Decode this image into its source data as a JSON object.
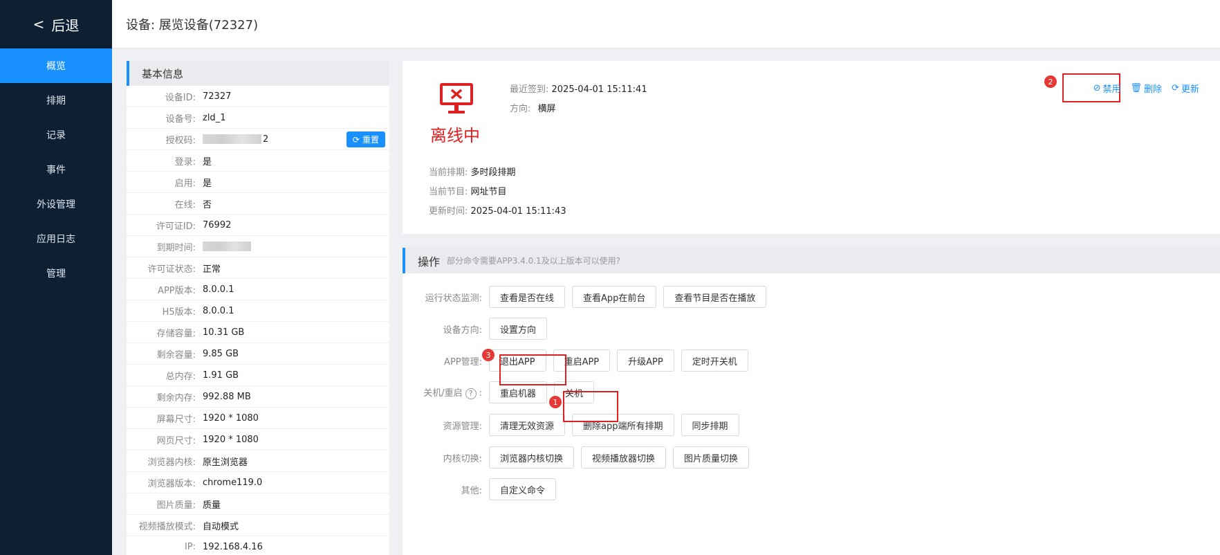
{
  "sidebar": {
    "back_label": "后退",
    "items": [
      {
        "label": "概览",
        "active": true
      },
      {
        "label": "排期"
      },
      {
        "label": "记录"
      },
      {
        "label": "事件"
      },
      {
        "label": "外设管理"
      },
      {
        "label": "应用日志"
      },
      {
        "label": "管理"
      }
    ]
  },
  "header": {
    "title": "设备: 展览设备(72327)"
  },
  "info": {
    "title": "基本信息",
    "reset_label": "重置",
    "rows": [
      {
        "label": "设备ID:",
        "value": "72327"
      },
      {
        "label": "设备号:",
        "value": "zld_1"
      },
      {
        "label": "授权码:",
        "value": "2"
      },
      {
        "label": "登录:",
        "value": "是"
      },
      {
        "label": "启用:",
        "value": "是"
      },
      {
        "label": "在线:",
        "value": "否"
      },
      {
        "label": "许可证ID:",
        "value": "76992"
      },
      {
        "label": "到期时间:",
        "value": ""
      },
      {
        "label": "许可证状态:",
        "value": "正常"
      },
      {
        "label": "APP版本:",
        "value": "8.0.0.1"
      },
      {
        "label": "H5版本:",
        "value": "8.0.0.1"
      },
      {
        "label": "存储容量:",
        "value": "10.31 GB"
      },
      {
        "label": "剩余容量:",
        "value": "9.85 GB"
      },
      {
        "label": "总内存:",
        "value": "1.91 GB"
      },
      {
        "label": "剩余内存:",
        "value": "992.88 MB"
      },
      {
        "label": "屏幕尺寸:",
        "value": "1920 * 1080"
      },
      {
        "label": "网页尺寸:",
        "value": "1920 * 1080"
      },
      {
        "label": "浏览器内核:",
        "value": "原生浏览器"
      },
      {
        "label": "浏览器版本:",
        "value": "chrome119.0"
      },
      {
        "label": "图片质量:",
        "value": "质量"
      },
      {
        "label": "视频播放模式:",
        "value": "自动模式"
      },
      {
        "label": "IP:",
        "value": "192.168.4.16"
      }
    ]
  },
  "status": {
    "state": "离线中",
    "last_signin_label": "最近签到:",
    "last_signin": "2025-04-01 15:11:41",
    "orientation_label": "方向:",
    "orientation": "横屏",
    "schedule_label": "当前排期:",
    "schedule": "多时段排期",
    "program_label": "当前节目:",
    "program": "网址节目",
    "updated_label": "更新时间:",
    "updated": "2025-04-01 15:11:43",
    "actions": {
      "disable": "禁用",
      "delete": "删除",
      "update": "更新"
    },
    "colors": {
      "offline": "#e02020",
      "accent": "#1890ff"
    }
  },
  "ops": {
    "title": "操作",
    "subtitle": "部分命令需要APP3.4.0.1及以上版本可以使用?",
    "rows": [
      {
        "label": "运行状态监测:",
        "buttons": [
          "查看是否在线",
          "查看App在前台",
          "查看节目是否在播放"
        ]
      },
      {
        "label": "设备方向:",
        "buttons": [
          "设置方向"
        ]
      },
      {
        "label": "APP管理:",
        "buttons": [
          "退出APP",
          "重启APP",
          "升级APP",
          "定时开关机"
        ]
      },
      {
        "label": "关机/重启",
        "buttons": [
          "重启机器",
          "关机"
        ]
      },
      {
        "label": "资源管理:",
        "buttons": [
          "清理无效资源",
          "删除app端所有排期",
          "同步排期"
        ]
      },
      {
        "label": "内核切换:",
        "buttons": [
          "浏览器内核切换",
          "视频播放器切换",
          "图片质量切换"
        ]
      },
      {
        "label": "其他:",
        "buttons": [
          "自定义命令"
        ]
      }
    ],
    "help_glyph": "?",
    "colon": ":"
  },
  "badges": {
    "one": "1",
    "two": "2",
    "three": "3"
  }
}
